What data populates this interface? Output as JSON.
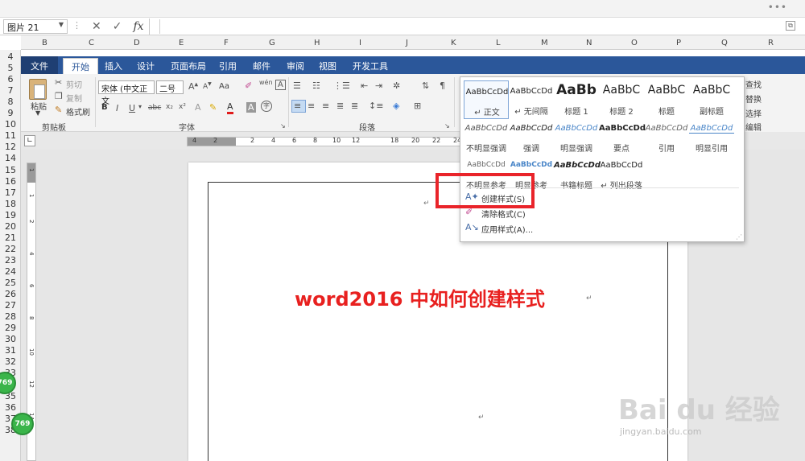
{
  "excel": {
    "name_box": "图片 21",
    "columns": [
      "B",
      "C",
      "D",
      "E",
      "F",
      "G",
      "H",
      "I",
      "J",
      "K",
      "L",
      "M",
      "N",
      "O",
      "P",
      "Q",
      "R"
    ],
    "rows": [
      "4",
      "5",
      "6",
      "7",
      "8",
      "9",
      "10",
      "11",
      "12",
      "14",
      "15",
      "16",
      "17",
      "18",
      "19",
      "20",
      "21",
      "22",
      "23",
      "24",
      "25",
      "26",
      "27",
      "28",
      "29",
      "30",
      "31",
      "32",
      "33",
      "34",
      "35",
      "36",
      "37",
      "38"
    ],
    "fx_label": "fx",
    "dots": "•••"
  },
  "word_tabs": [
    "文件",
    "开始",
    "插入",
    "设计",
    "页面布局",
    "引用",
    "邮件",
    "审阅",
    "视图",
    "开发工具"
  ],
  "ribbon": {
    "clipboard": {
      "paste": "粘贴",
      "cut": "剪切",
      "copy": "复制",
      "format_painter": "格式刷",
      "label": "剪贴板"
    },
    "font": {
      "font_name": "宋体 (中文正文",
      "font_size": "二号",
      "label": "字体",
      "aa": "Aa"
    },
    "paragraph": {
      "label": "段落"
    },
    "editing": {
      "find": "查找",
      "replace": "替换",
      "select": "选择",
      "label": "编辑"
    }
  },
  "ruler_h": [
    "4",
    "2",
    "2",
    "4",
    "6",
    "8",
    "10",
    "12",
    "18",
    "20",
    "22",
    "24"
  ],
  "ruler_v": [
    "1",
    "1",
    "2",
    "4",
    "6",
    "8",
    "10",
    "12",
    "14"
  ],
  "styles_panel": {
    "row1": [
      {
        "sample": "AaBbCcDd",
        "name": "↵ 正文"
      },
      {
        "sample": "AaBbCcDd",
        "name": "↵ 无间隔"
      },
      {
        "sample": "AaBb",
        "name": "标题 1"
      },
      {
        "sample": "AaBbC",
        "name": "标题 2"
      },
      {
        "sample": "AaBbC",
        "name": "标题"
      },
      {
        "sample": "AaBbC",
        "name": "副标题"
      }
    ],
    "row2": [
      {
        "sample": "AaBbCcDd",
        "name": "不明显强调"
      },
      {
        "sample": "AaBbCcDd",
        "name": "强调"
      },
      {
        "sample": "AaBbCcDd",
        "name": "明显强调"
      },
      {
        "sample": "AaBbCcDd",
        "name": "要点"
      },
      {
        "sample": "AaBbCcDd",
        "name": "引用"
      },
      {
        "sample": "AaBbCcDd",
        "name": "明显引用"
      }
    ],
    "row3": [
      {
        "sample": "AaBbCcDd",
        "name": "不明显参考"
      },
      {
        "sample": "AaBbCcDd",
        "name": "明显参考"
      },
      {
        "sample": "AaBbCcDd",
        "name": "书籍标题"
      },
      {
        "sample": "AaBbCcDd",
        "name": "↵ 列出段落"
      }
    ],
    "menu": [
      {
        "label": "创建样式(S)",
        "icon": "create-style-icon"
      },
      {
        "label": "清除格式(C)",
        "icon": "eraser-icon"
      },
      {
        "label": "应用样式(A)...",
        "icon": "apply-style-icon"
      }
    ]
  },
  "document": {
    "title": "word2016 中如何创建样式",
    "para_mark": "↵"
  },
  "badges": {
    "b1": "769",
    "b2": "769"
  },
  "watermark": {
    "text": "Bai du 经验",
    "url": "jingyan.baidu.com"
  },
  "colors": {
    "accent": "#2b579a",
    "highlight": "#e9242a",
    "title": "#e8201f"
  }
}
